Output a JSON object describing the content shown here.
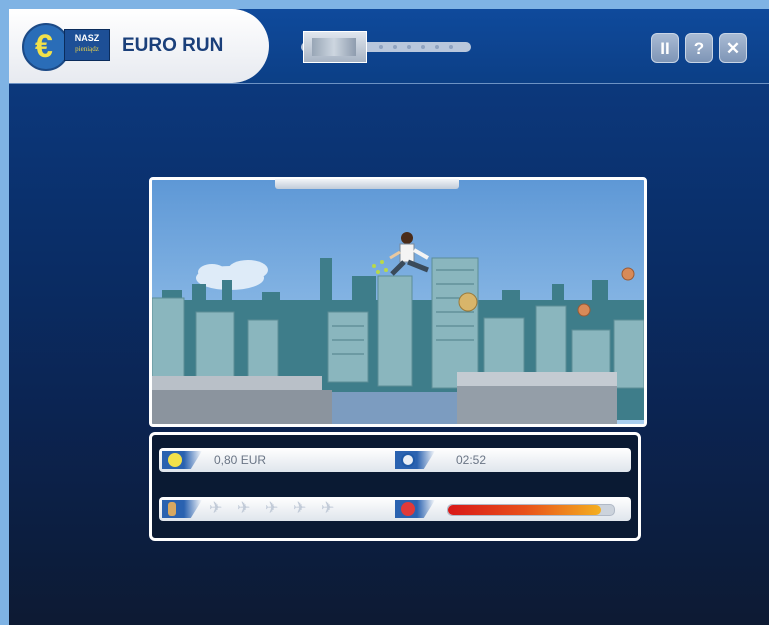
{
  "header": {
    "logo_text_top": "NASZ",
    "logo_text_bottom": "pieniądz",
    "logo_symbol": "€",
    "title": "EURO RUN",
    "level_progress": 0.0
  },
  "controls": {
    "pause_label": "II",
    "help_label": "?",
    "close_label": "✕"
  },
  "hud": {
    "money_value": "0,80 EUR",
    "timer_value": "02:52",
    "lives_total": 5,
    "life_glyph": "✈",
    "energy_fraction": 0.92
  },
  "colors": {
    "brand_blue": "#0c3f86",
    "accent_yellow": "#f2e14a",
    "energy_red": "#d81818",
    "energy_orange": "#f4b020"
  },
  "icons": {
    "money": "euro-coin-icon",
    "timer": "clock-icon",
    "lives": "runner-icon",
    "energy": "heart-icon"
  }
}
